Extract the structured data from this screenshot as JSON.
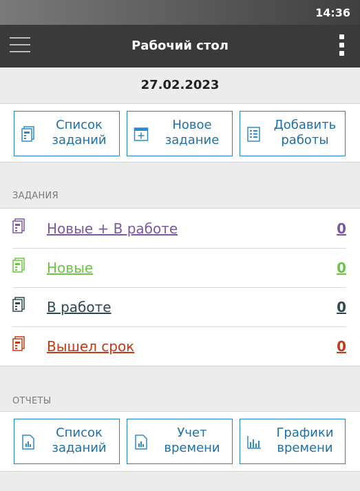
{
  "status_bar": {
    "time": "14:36"
  },
  "app_bar": {
    "title": "Рабочий стол",
    "menu_icon": "hamburger-icon",
    "more_icon": "more-vert-icon"
  },
  "date": "27.02.2023",
  "quick_actions": [
    {
      "label_line1": "Список",
      "label_line2": "заданий",
      "icon": "task-list-icon"
    },
    {
      "label_line1": "Новое",
      "label_line2": "задание",
      "icon": "new-task-icon"
    },
    {
      "label_line1": "Добавить",
      "label_line2": "работы",
      "icon": "add-work-icon"
    }
  ],
  "tasks_section": {
    "title": "ЗАДАНИЯ",
    "items": [
      {
        "label": "Новые + В работе",
        "count": "0",
        "color": "#7b57a6"
      },
      {
        "label": "Новые",
        "count": "0",
        "color": "#6ec545"
      },
      {
        "label": "В работе",
        "count": "0",
        "color": "#2e4a4e"
      },
      {
        "label": "Вышел срок",
        "count": "0",
        "color": "#c43a16"
      }
    ]
  },
  "reports_section": {
    "title": "ОТЧЕТЫ",
    "buttons": [
      {
        "label_line1": "Список",
        "label_line2": "заданий",
        "icon": "report-list-icon"
      },
      {
        "label_line1": "Учет",
        "label_line2": "времени",
        "icon": "time-report-icon"
      },
      {
        "label_line1": "Графики",
        "label_line2": "времени",
        "icon": "time-chart-icon"
      }
    ]
  },
  "colors": {
    "accent": "#1d86c8",
    "appbar": "#3a3a3a"
  }
}
